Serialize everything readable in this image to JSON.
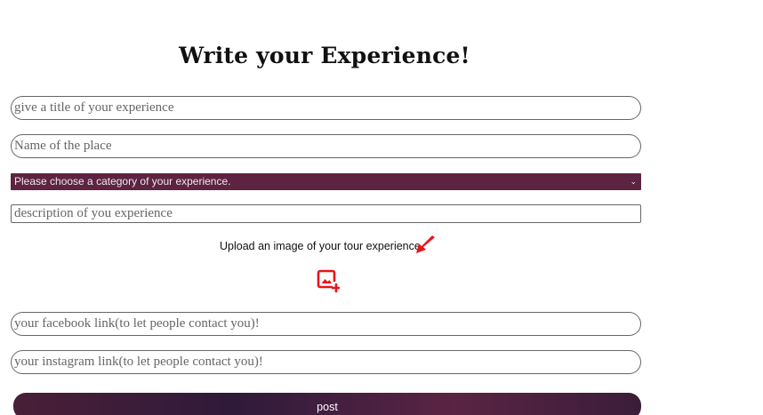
{
  "form": {
    "heading": "Write your Experience!",
    "title_input": {
      "placeholder": "give a title of your experience"
    },
    "place_input": {
      "placeholder": "Name of the place"
    },
    "category_select": {
      "selected": "Please choose a category of your experience."
    },
    "description_input": {
      "placeholder": "description of you experience"
    },
    "upload": {
      "label": "Upload an image of your tour experience",
      "arrow_icon": "red-arrow-down-left-icon",
      "image_icon": "add-image-icon",
      "icon_color": "#e8141b"
    },
    "facebook_input": {
      "placeholder": "your facebook link(to let people contact you)!"
    },
    "instagram_input": {
      "placeholder": "your instagram link(to let people contact you)!"
    },
    "post_button": {
      "label": "post"
    },
    "accent_color": "#5c2440"
  }
}
